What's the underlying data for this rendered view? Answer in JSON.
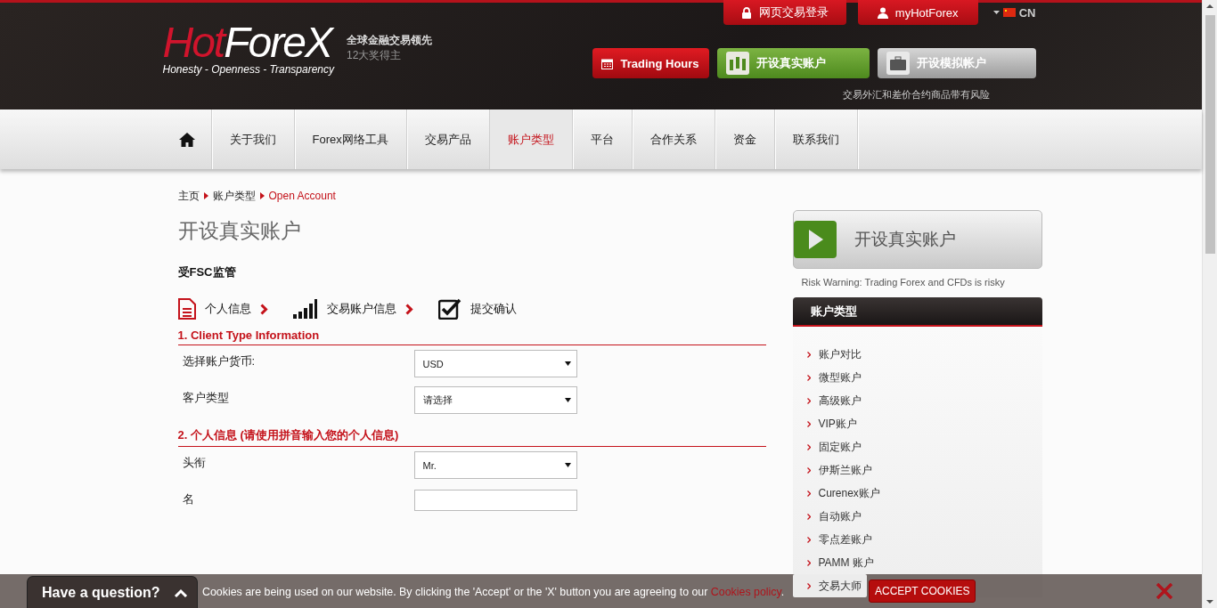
{
  "header": {
    "logo": {
      "wordmark_red": "Hot",
      "wordmark_white": "ForeX",
      "tagline": "Honesty - Openness - Transparency"
    },
    "slogan": "全球金融交易领先",
    "awards": "12大奖得主",
    "top_buttons": [
      {
        "label": "网页交易登录",
        "kind": "weblogin"
      },
      {
        "label": "myHotForex",
        "kind": "profile"
      }
    ],
    "language": "CN",
    "action_buttons": [
      {
        "label": "Trading Hours",
        "kind": "hours"
      },
      {
        "label": "开设真实账户",
        "kind": "live"
      },
      {
        "label": "开设模拟帐户",
        "kind": "demo"
      }
    ],
    "risk_note": "交易外汇和差价合约商品带有风险"
  },
  "nav": {
    "items": [
      {
        "kind": "home",
        "selected": false
      },
      {
        "label": "关于我们",
        "kind": "text",
        "selected": false
      },
      {
        "label": "Forex网络工具",
        "kind": "text",
        "selected": false
      },
      {
        "label": "交易产品",
        "kind": "text",
        "selected": false
      },
      {
        "label": "账户类型",
        "kind": "text",
        "selected": true
      },
      {
        "label": "平台",
        "kind": "text",
        "selected": false
      },
      {
        "label": "合作关系",
        "kind": "text",
        "selected": false
      },
      {
        "label": "资金",
        "kind": "text",
        "selected": false
      },
      {
        "label": "联系我们",
        "kind": "text",
        "selected": false
      }
    ]
  },
  "breadcrumb": [
    "主页",
    "账户类型",
    "Open Account"
  ],
  "page_title": "开设真实账户",
  "regulator": "受FSC监管",
  "steps": [
    {
      "label": "个人信息",
      "kind": "document"
    },
    {
      "label": "交易账户信息",
      "kind": "signal"
    },
    {
      "label": "提交确认",
      "kind": "check"
    }
  ],
  "sections": [
    {
      "title": "1. Client Type Information",
      "fields": [
        {
          "label": "选择账户货币:",
          "kind": "select",
          "value": "USD"
        },
        {
          "label": "客户类型",
          "kind": "select",
          "value": "请选择"
        }
      ]
    },
    {
      "title": "2. 个人信息 (请使用拼音输入您的个人信息)",
      "fields": [
        {
          "label": "头衔",
          "kind": "select",
          "value": "Mr."
        },
        {
          "label": "名",
          "kind": "text"
        }
      ]
    }
  ],
  "sidebar": {
    "cta": "开设真实账户",
    "risk_warning": "Risk Warning: Trading Forex and CFDs is risky",
    "menu_title": "账户类型",
    "items": [
      "账户对比",
      "微型账户",
      "高级账户",
      "VIP账户",
      "固定账户",
      "伊斯兰账户",
      "Curenex账户",
      "自动账户",
      "零点差账户",
      "PAMM 账户",
      "交易大师"
    ]
  },
  "cookie_bar": {
    "question": "Have a question?",
    "message": "Cookies are being used on our website. By clicking the 'Accept' or the 'X' button you are agreeing to our ",
    "link": "Cookies policy",
    "after_link": ".",
    "accept": "ACCEPT COOKIES"
  }
}
